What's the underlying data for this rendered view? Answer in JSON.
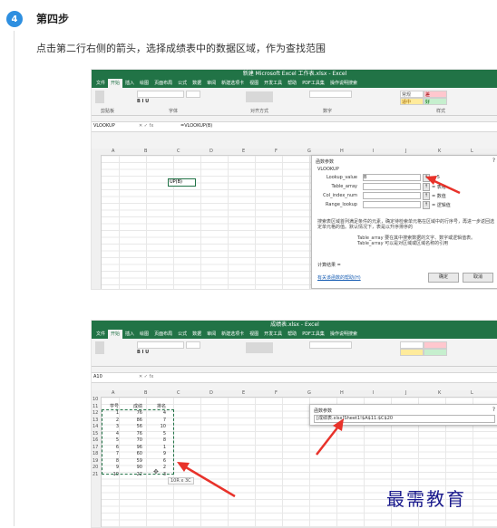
{
  "step": {
    "number": "4",
    "title": "第四步",
    "description": "点击第二行右侧的箭头，选择成绩表中的数据区域，作为查找范围"
  },
  "shot1": {
    "window_title": "新建 Microsoft Excel 工作表.xlsx - Excel",
    "tabs": [
      "文件",
      "开始",
      "插入",
      "绘图",
      "页面布局",
      "公式",
      "数据",
      "审阅",
      "新建选项卡",
      "视图",
      "开发工具",
      "帮助",
      "PDF工具集",
      "操作说明搜索"
    ],
    "ribbon_groups": [
      "剪贴板",
      "字体",
      "对齐方式",
      "数字",
      "样式"
    ],
    "styles": [
      "常规",
      "差",
      "适中",
      "好"
    ],
    "name_box": "VLOOKUP",
    "formula": "=VLOOKUP(B)",
    "columns": [
      "A",
      "B",
      "C",
      "D",
      "E",
      "F",
      "G",
      "H",
      "I",
      "J",
      "K",
      "L"
    ],
    "cell_text": "UP(B)",
    "dialog": {
      "title": "函数参数",
      "close": "?",
      "function_name": "VLOOKUP",
      "args": [
        {
          "label": "Lookup_value",
          "value": "B",
          "result": "= 5"
        },
        {
          "label": "Table_array",
          "value": "",
          "result": "= 表格"
        },
        {
          "label": "Col_index_num",
          "value": "",
          "result": "= 数值"
        },
        {
          "label": "Range_lookup",
          "value": "",
          "result": "= 逻辑值"
        }
      ],
      "desc_line1": "搜索表区域首列满足条件的元素，确定待检索单元格在区域中的行序号，再进一步返回选定单元格的值。默认情况下，表是以升序排序的",
      "desc_line2": "Table_array  要在其中搜索数据的文字、数字或逻辑值表。Table_array 可以是对区域或区域名称的引用",
      "result_label": "计算结果 =",
      "help_link": "有关该函数的帮助(H)",
      "ok": "确定",
      "cancel": "取消"
    }
  },
  "shot2": {
    "window_title": "成绩表.xlsx - Excel",
    "tabs": [
      "文件",
      "开始",
      "插入",
      "绘图",
      "页面布局",
      "公式",
      "数据",
      "审阅",
      "新建选项卡",
      "视图",
      "开发工具",
      "帮助",
      "PDF工具集",
      "操作说明搜索"
    ],
    "name_box": "A10",
    "columns": [
      "A",
      "B",
      "C",
      "D",
      "E",
      "F",
      "G",
      "H",
      "I",
      "J",
      "K",
      "L"
    ],
    "table_header": [
      "学号",
      "成绩",
      "排名"
    ],
    "table_rows": [
      [
        "1",
        "76",
        "4"
      ],
      [
        "2",
        "86",
        "7"
      ],
      [
        "3",
        "56",
        "10"
      ],
      [
        "4",
        "76",
        "5"
      ],
      [
        "5",
        "70",
        "8"
      ],
      [
        "6",
        "96",
        "1"
      ],
      [
        "7",
        "60",
        "9"
      ],
      [
        "8",
        "59",
        "6"
      ],
      [
        "9",
        "90",
        "2"
      ],
      [
        "10",
        "22",
        "3"
      ]
    ],
    "row_numbers": [
      "10",
      "11",
      "12",
      "13",
      "14",
      "15",
      "16",
      "17",
      "18",
      "19",
      "20",
      "21"
    ],
    "selection_hint": "10R x 3C",
    "dialog": {
      "title": "函数参数",
      "close": "?",
      "range_text": "[成绩表.xlsx]Sheet1!$A$11:$C$20"
    }
  },
  "watermark": "最需教育",
  "colors": {
    "excel_green": "#217346",
    "badge_blue": "#2e8fe0",
    "arrow_red": "#e8322a",
    "watermark": "#1a1a8c"
  }
}
